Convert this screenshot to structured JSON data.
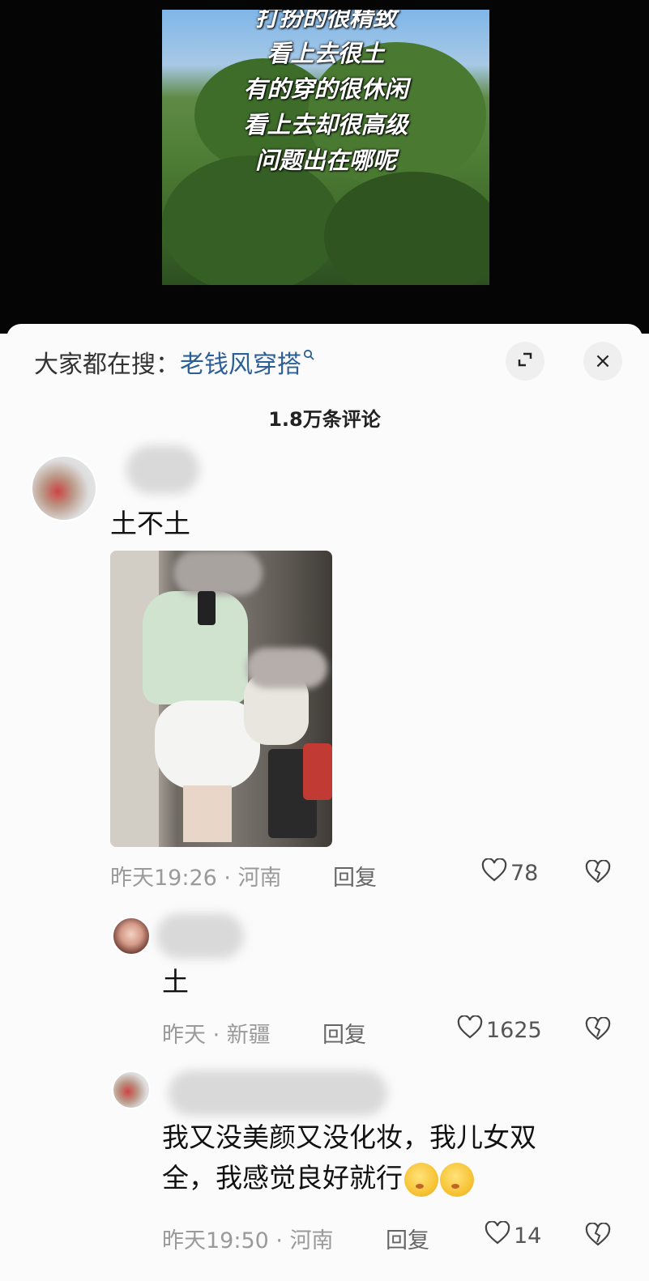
{
  "video": {
    "caption_lines": [
      "打扮的很精致",
      "看上去很土",
      "有的穿的很休闲",
      "看上去却很高级",
      "问题出在哪呢"
    ]
  },
  "search": {
    "prefix": "大家都在搜：",
    "term": "老钱风穿搭",
    "term_icon": "search-icon"
  },
  "header": {
    "comment_count": "1.8万条评论",
    "expand_icon": "expand-icon",
    "close_label": "×"
  },
  "comments": [
    {
      "text": "土不土",
      "time": "昨天19:26",
      "location": "河南",
      "reply_label": "回复",
      "likes": "78"
    },
    {
      "text": "土",
      "time": "昨天",
      "location": "新疆",
      "reply_label": "回复",
      "likes": "1625"
    },
    {
      "text_line1": "我又没美颜又没化妆，我儿女双",
      "text_line2": "全，我感觉良好就行",
      "time": "昨天19:50",
      "location": "河南",
      "reply_label": "回复",
      "likes": "14"
    }
  ],
  "separator": " · ",
  "colors": {
    "search_term": "#2c5f95",
    "meta": "#9a9a9a",
    "background": "#fbfbfb"
  }
}
